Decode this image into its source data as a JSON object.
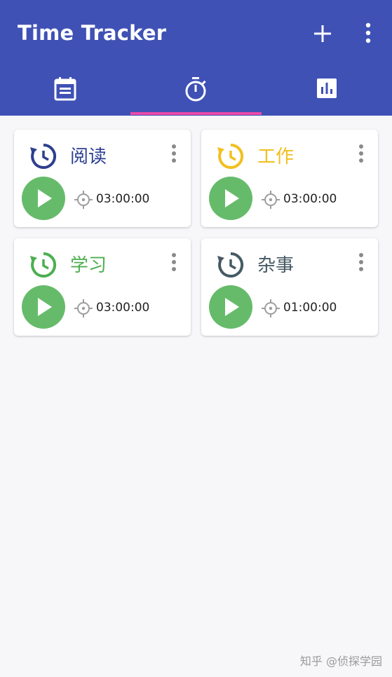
{
  "app": {
    "title": "Time Tracker"
  },
  "toolbar": {
    "add_icon": "plus-icon",
    "more_icon": "more-vertical-icon"
  },
  "tabs": [
    {
      "icon": "calendar-list-icon",
      "selected": false
    },
    {
      "icon": "stopwatch-icon",
      "selected": true
    },
    {
      "icon": "bar-chart-icon",
      "selected": false
    }
  ],
  "colors": {
    "appbar": "#3f51b5",
    "tab_indicator": "#e94aa8",
    "play_button": "#66bb6a"
  },
  "cards": [
    {
      "name": "阅读",
      "time": "03:00:00",
      "color": "#2e3f8f"
    },
    {
      "name": "工作",
      "time": "03:00:00",
      "color": "#f2bf1f"
    },
    {
      "name": "学习",
      "time": "03:00:00",
      "color": "#4caf50"
    },
    {
      "name": "杂事",
      "time": "01:00:00",
      "color": "#455a64"
    }
  ],
  "watermark": "知乎 @侦探学园"
}
